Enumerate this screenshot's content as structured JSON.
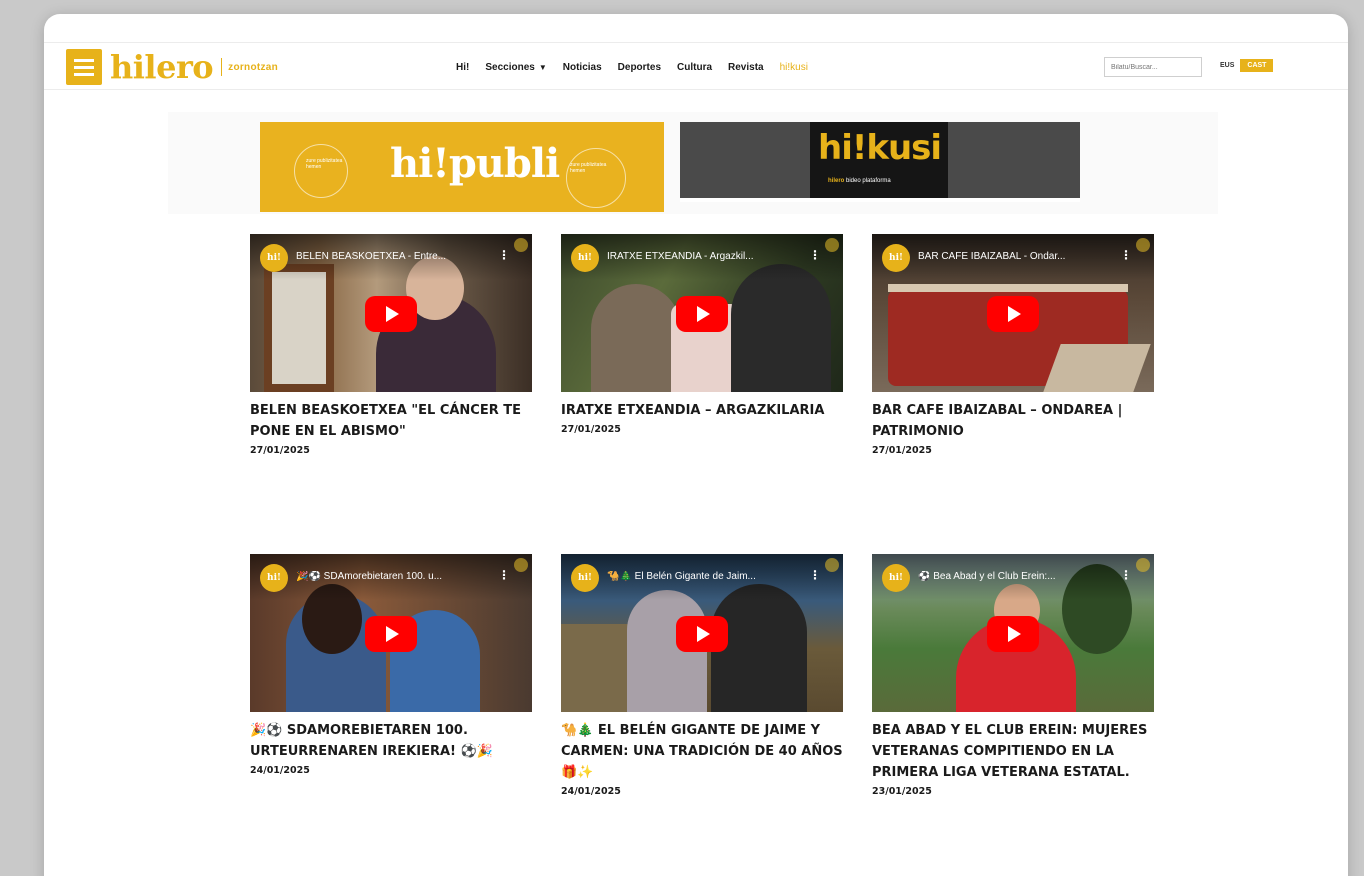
{
  "header": {
    "logo": {
      "word": "hilero",
      "sub": "zornotzan"
    },
    "nav": [
      {
        "label": "Hi!"
      },
      {
        "label": "Secciones",
        "caret": "▼"
      },
      {
        "label": "Noticias"
      },
      {
        "label": "Deportes"
      },
      {
        "label": "Cultura"
      },
      {
        "label": "Revista"
      },
      {
        "label": "hi!kusi"
      }
    ],
    "search_placeholder": "Bilatu/Buscar...",
    "lang": {
      "eus": "EUS",
      "cast": "CAST"
    }
  },
  "banners": {
    "publi": {
      "word": "hi!publi",
      "left_text": "zure publizitatea hemen",
      "right_text": "zure publizitatea hemen"
    },
    "kusi": {
      "word": "hi!kusi",
      "tag_brand": "hilero",
      "tag_text": "bideo plataforma"
    }
  },
  "cards": [
    {
      "video_title": "BELEN BEASKOETXEA - Entre...",
      "title": "BELEN BEASKOETXEA \"EL CÁNCER TE PONE EN EL ABISMO\"",
      "date": "27/01/2025"
    },
    {
      "video_title": "IRATXE ETXEANDIA - Argazkil...",
      "title": "IRATXE ETXEANDIA – ARGAZKILARIA",
      "date": "27/01/2025"
    },
    {
      "video_title": "BAR CAFE IBAIZABAL - Ondar...",
      "title": "BAR CAFE IBAIZABAL – ONDAREA | PATRIMONIO",
      "date": "27/01/2025"
    },
    {
      "video_title": "🎉⚽ SDAmorebietaren 100. u...",
      "title": "🎉⚽ SDAMOREBIETAREN 100. URTEURRENAREN IREKIERA! ⚽🎉",
      "date": "24/01/2025"
    },
    {
      "video_title": "🐪🎄 El Belén Gigante de Jaim...",
      "title": "🐪🎄 EL BELÉN GIGANTE DE JAIME Y CARMEN: UNA TRADICIÓN DE 40 AÑOS 🎁✨",
      "date": "24/01/2025"
    },
    {
      "video_title": "⚽ Bea Abad y el Club Erein:...",
      "title": "BEA ABAD Y EL CLUB EREIN: MUJERES VETERANAS COMPITIENDO EN LA PRIMERA LIGA VETERANA ESTATAL.",
      "date": "23/01/2025"
    }
  ],
  "channel_avatar": "hi!",
  "colors": {
    "brand": "#e7b21a",
    "play": "#ff0000",
    "text": "#1a1a1a"
  }
}
